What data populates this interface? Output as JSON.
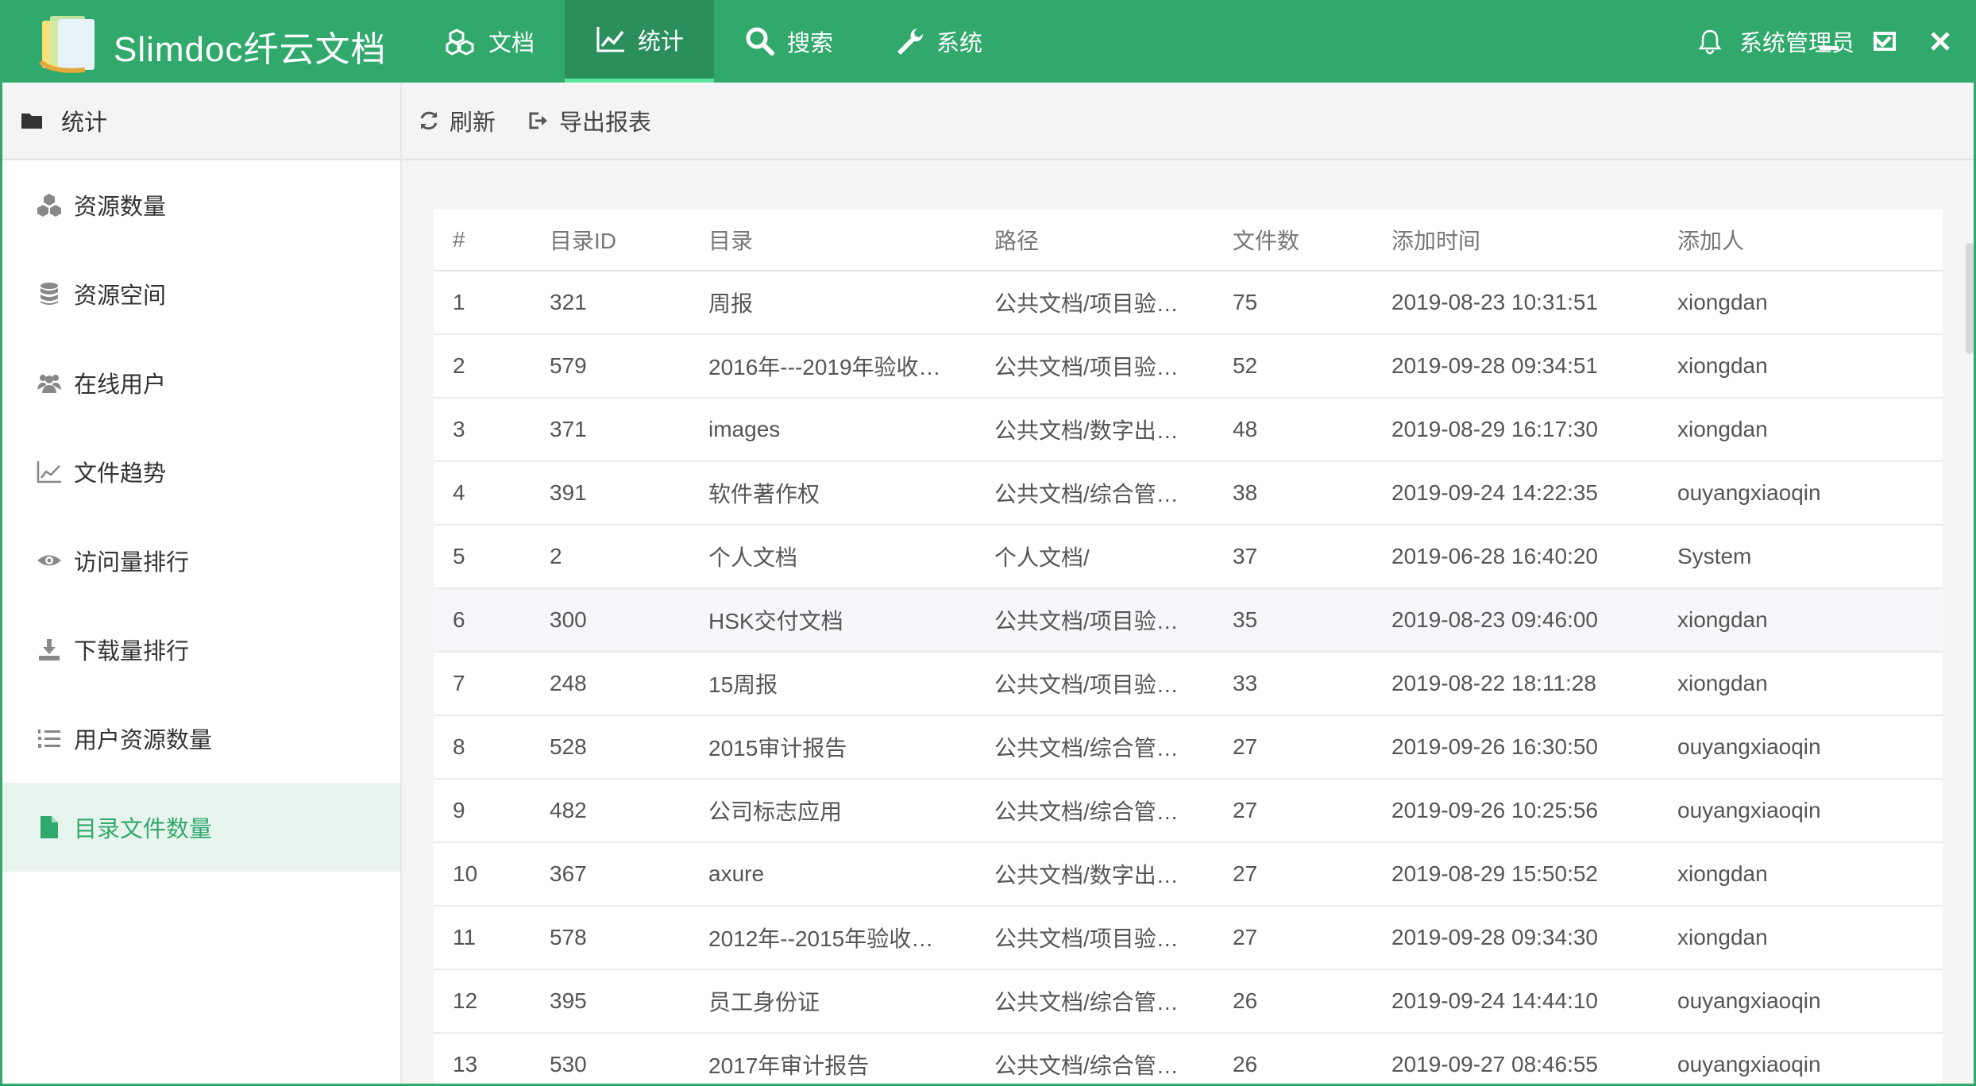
{
  "app": {
    "title": "Slimdoc纤云文档"
  },
  "nav": [
    {
      "label": "文档",
      "icon": "cubes-icon"
    },
    {
      "label": "统计",
      "icon": "chart-line-icon",
      "active": true
    },
    {
      "label": "搜索",
      "icon": "search-icon"
    },
    {
      "label": "系统",
      "icon": "wrench-icon"
    }
  ],
  "user": {
    "name": "系统管理员"
  },
  "sidebar": {
    "header": "统计",
    "items": [
      {
        "label": "资源数量",
        "icon": "cubes-icon"
      },
      {
        "label": "资源空间",
        "icon": "database-icon"
      },
      {
        "label": "在线用户",
        "icon": "users-icon"
      },
      {
        "label": "文件趋势",
        "icon": "line-chart-icon"
      },
      {
        "label": "访问量排行",
        "icon": "eye-icon"
      },
      {
        "label": "下载量排行",
        "icon": "download-icon"
      },
      {
        "label": "用户资源数量",
        "icon": "list-ol-icon"
      },
      {
        "label": "目录文件数量",
        "icon": "file-icon",
        "active": true
      }
    ]
  },
  "toolbar": {
    "refresh_label": "刷新",
    "export_label": "导出报表"
  },
  "table": {
    "columns": [
      "#",
      "目录ID",
      "目录",
      "路径",
      "文件数",
      "添加时间",
      "添加人"
    ],
    "rows": [
      [
        "1",
        "321",
        "周报",
        "公共文档/项目验…",
        "75",
        "2019-08-23 10:31:51",
        "xiongdan"
      ],
      [
        "2",
        "579",
        "2016年---2019年验收…",
        "公共文档/项目验…",
        "52",
        "2019-09-28 09:34:51",
        "xiongdan"
      ],
      [
        "3",
        "371",
        "images",
        "公共文档/数字出…",
        "48",
        "2019-08-29 16:17:30",
        "xiongdan"
      ],
      [
        "4",
        "391",
        "软件著作权",
        "公共文档/综合管…",
        "38",
        "2019-09-24 14:22:35",
        "ouyangxiaoqin"
      ],
      [
        "5",
        "2",
        "个人文档",
        "个人文档/",
        "37",
        "2019-06-28 16:40:20",
        "System"
      ],
      [
        "6",
        "300",
        "HSK交付文档",
        "公共文档/项目验…",
        "35",
        "2019-08-23 09:46:00",
        "xiongdan"
      ],
      [
        "7",
        "248",
        "15周报",
        "公共文档/项目验…",
        "33",
        "2019-08-22 18:11:28",
        "xiongdan"
      ],
      [
        "8",
        "528",
        "2015审计报告",
        "公共文档/综合管…",
        "27",
        "2019-09-26 16:30:50",
        "ouyangxiaoqin"
      ],
      [
        "9",
        "482",
        "公司标志应用",
        "公共文档/综合管…",
        "27",
        "2019-09-26 10:25:56",
        "ouyangxiaoqin"
      ],
      [
        "10",
        "367",
        "axure",
        "公共文档/数字出…",
        "27",
        "2019-08-29 15:50:52",
        "xiongdan"
      ],
      [
        "11",
        "578",
        "2012年--2015年验收…",
        "公共文档/项目验…",
        "27",
        "2019-09-28 09:34:30",
        "xiongdan"
      ],
      [
        "12",
        "395",
        "员工身份证",
        "公共文档/综合管…",
        "26",
        "2019-09-24 14:44:10",
        "ouyangxiaoqin"
      ],
      [
        "13",
        "530",
        "2017年审计报告",
        "公共文档/综合管…",
        "26",
        "2019-09-27 08:46:55",
        "ouyangxiaoqin"
      ]
    ],
    "highlighted_row": 6
  },
  "colors": {
    "brand": "#32a96c",
    "brand_dark": "#2a8f5c",
    "active_text": "#32a96c"
  }
}
